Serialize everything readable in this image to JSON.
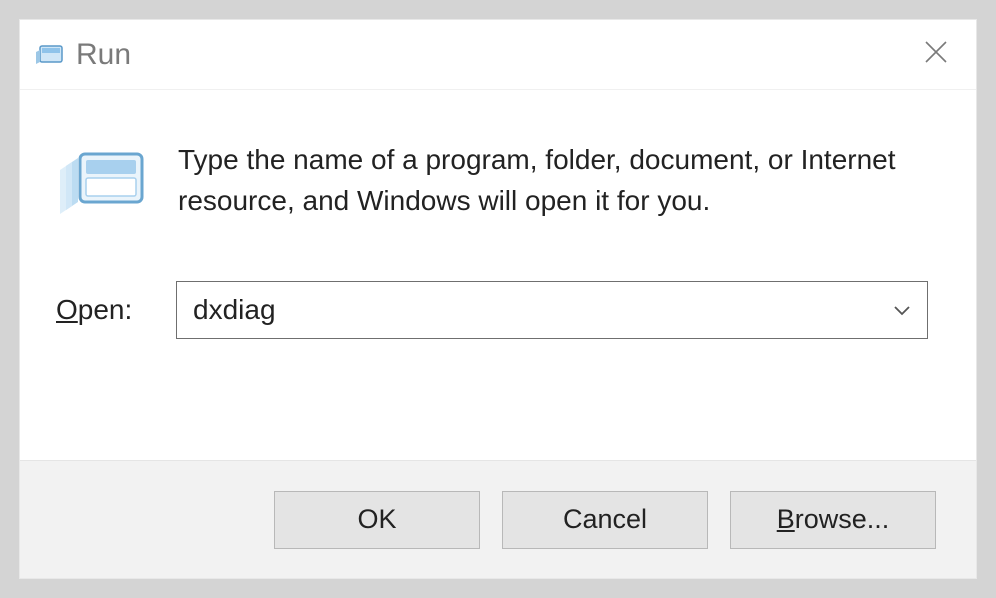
{
  "titlebar": {
    "title": "Run"
  },
  "body": {
    "description": "Type the name of a program, folder, document, or Internet resource, and Windows will open it for you.",
    "open_label_underline": "O",
    "open_label_rest": "pen:",
    "input_value": "dxdiag"
  },
  "buttons": {
    "ok": "OK",
    "cancel": "Cancel",
    "browse_underline": "B",
    "browse_rest": "rowse..."
  }
}
